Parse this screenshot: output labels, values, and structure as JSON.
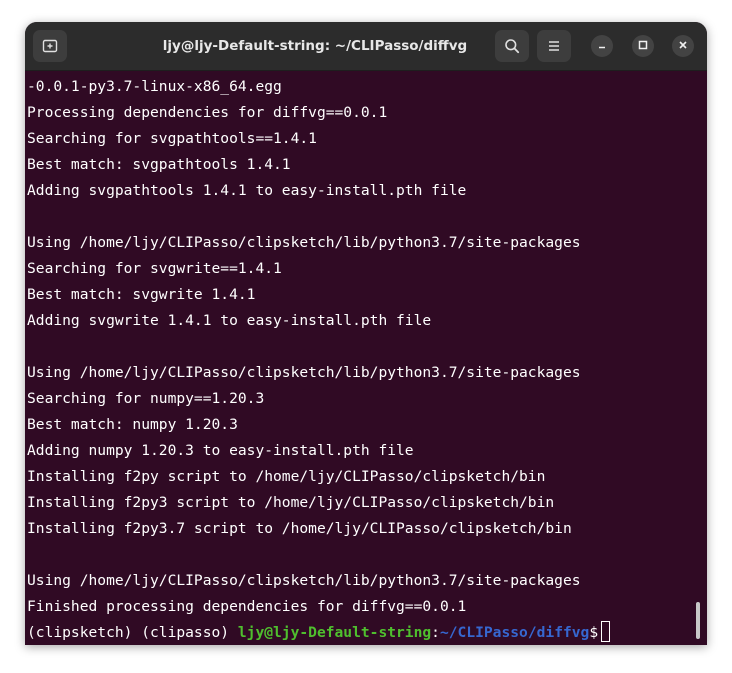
{
  "window": {
    "title": "ljy@ljy-Default-string: ~/CLIPasso/diffvg"
  },
  "icons": {
    "new_tab": "new-tab-icon",
    "search": "search-icon",
    "menu": "hamburger-menu-icon",
    "minimize": "minimize-icon",
    "maximize": "maximize-icon",
    "close": "close-icon"
  },
  "colors": {
    "terminal_bg": "#300a24",
    "titlebar_bg": "#2c2c2c",
    "prompt_user": "#4fbf2e",
    "prompt_path": "#3667d0"
  },
  "terminal": {
    "lines": [
      "-0.0.1-py3.7-linux-x86_64.egg",
      "Processing dependencies for diffvg==0.0.1",
      "Searching for svgpathtools==1.4.1",
      "Best match: svgpathtools 1.4.1",
      "Adding svgpathtools 1.4.1 to easy-install.pth file",
      "",
      "Using /home/ljy/CLIPasso/clipsketch/lib/python3.7/site-packages",
      "Searching for svgwrite==1.4.1",
      "Best match: svgwrite 1.4.1",
      "Adding svgwrite 1.4.1 to easy-install.pth file",
      "",
      "Using /home/ljy/CLIPasso/clipsketch/lib/python3.7/site-packages",
      "Searching for numpy==1.20.3",
      "Best match: numpy 1.20.3",
      "Adding numpy 1.20.3 to easy-install.pth file",
      "Installing f2py script to /home/ljy/CLIPasso/clipsketch/bin",
      "Installing f2py3 script to /home/ljy/CLIPasso/clipsketch/bin",
      "Installing f2py3.7 script to /home/ljy/CLIPasso/clipsketch/bin",
      "",
      "Using /home/ljy/CLIPasso/clipsketch/lib/python3.7/site-packages",
      "Finished processing dependencies for diffvg==0.0.1"
    ],
    "prompt": {
      "env": "(clipsketch) (clipasso) ",
      "user_host": "ljy@ljy-Default-string",
      "colon": ":",
      "path": "~/CLIPasso/diffvg",
      "symbol": "$"
    }
  }
}
